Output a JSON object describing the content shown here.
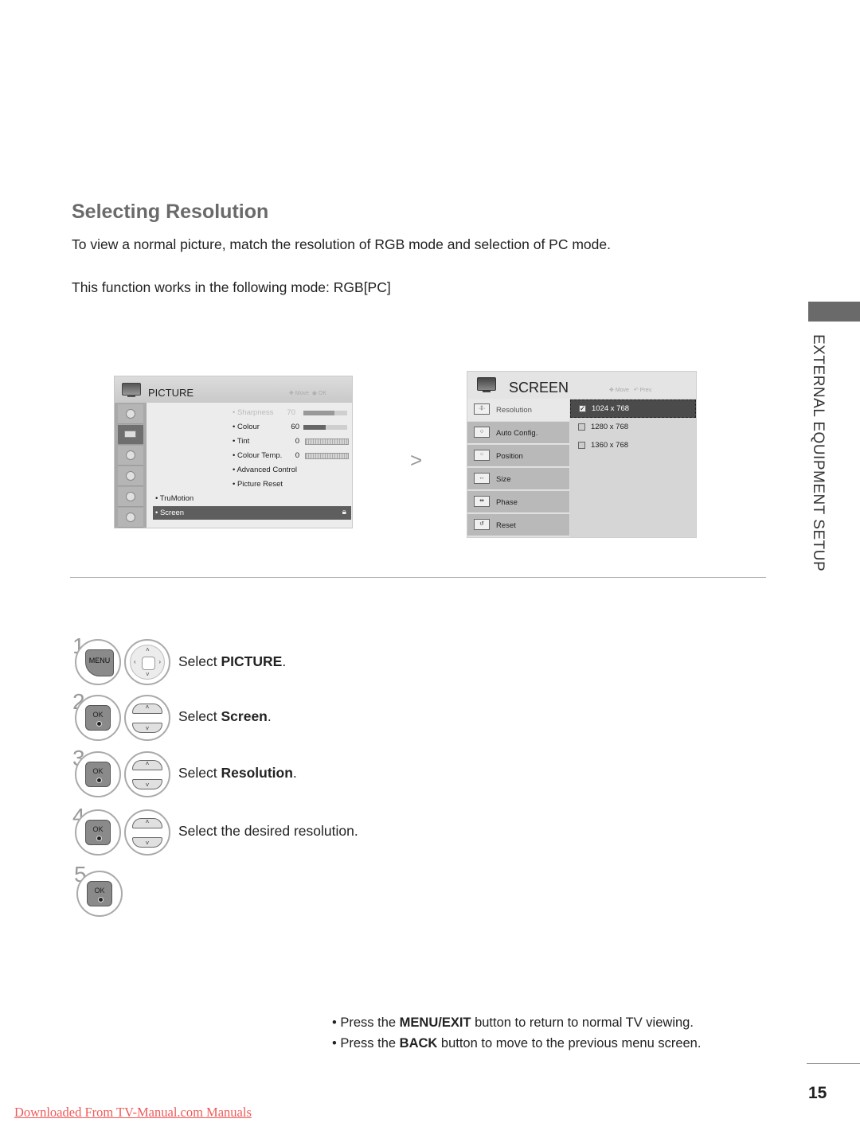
{
  "page": {
    "title": "Selecting Resolution",
    "intro": "To view a normal picture, match the resolution of RGB mode and selection of PC mode.",
    "mode_note": "This function works in the following mode: RGB[PC]",
    "section_label": "EXTERNAL EQUIPMENT SETUP",
    "page_number": "15",
    "footer_link": "Downloaded From TV-Manual.com Manuals"
  },
  "picture_menu": {
    "title": "PICTURE",
    "hint_move": "Move",
    "hint_ok": "OK",
    "sidebar_icons": [
      "picture-mode-icon",
      "picture-icon",
      "audio-icon",
      "time-icon",
      "lock-icon",
      "option-icon"
    ],
    "items": [
      {
        "label": "• Sharpness",
        "value": "70",
        "control": "bar",
        "level": 0.7,
        "faded": true
      },
      {
        "label": "• Colour",
        "value": "60",
        "control": "bar",
        "level": 0.5
      },
      {
        "label": "• Tint",
        "value": "0",
        "control": "scale",
        "scale_left": "R",
        "scale_right": "G"
      },
      {
        "label": "• Colour Temp.",
        "value": "0",
        "control": "scale",
        "scale_left": "W",
        "scale_right": "C"
      },
      {
        "label": "• Advanced Control"
      },
      {
        "label": "• Picture Reset"
      },
      {
        "label": "• TruMotion"
      },
      {
        "label": "• Screen",
        "selected": true
      }
    ]
  },
  "screen_menu": {
    "title": "SCREEN",
    "hint_move": "Move",
    "hint_prev": "Prev.",
    "items": [
      {
        "label": "Resolution",
        "active": true
      },
      {
        "label": "Auto Config."
      },
      {
        "label": "Position"
      },
      {
        "label": "Size"
      },
      {
        "label": "Phase"
      },
      {
        "label": "Reset"
      }
    ],
    "options": [
      {
        "label": "1024 x 768",
        "checked": true
      },
      {
        "label": "1280 x 768",
        "checked": false
      },
      {
        "label": "1360 x 768",
        "checked": false
      }
    ]
  },
  "steps": [
    {
      "num": "1",
      "prefix": "Select ",
      "bold": "PICTURE",
      "suffix": ".",
      "buttons": [
        "MENU",
        "NAV"
      ]
    },
    {
      "num": "2",
      "prefix": "Select ",
      "bold": "Screen",
      "suffix": ".",
      "buttons": [
        "OK",
        "UPDOWN"
      ]
    },
    {
      "num": "3",
      "prefix": "Select ",
      "bold": "Resolution",
      "suffix": ".",
      "buttons": [
        "OK",
        "UPDOWN"
      ]
    },
    {
      "num": "4",
      "prefix": "Select the desired resolution.",
      "bold": "",
      "suffix": "",
      "buttons": [
        "OK",
        "UPDOWN"
      ]
    },
    {
      "num": "5",
      "prefix": "",
      "bold": "",
      "suffix": "",
      "buttons": [
        "OK"
      ]
    }
  ],
  "button_labels": {
    "menu": "MENU",
    "ok": "OK"
  },
  "notes": [
    {
      "prefix": "• Press the ",
      "bold": "MENU/EXIT",
      "suffix": " button to return to normal TV viewing."
    },
    {
      "prefix": "• Press the ",
      "bold": "BACK",
      "suffix": " button to move to the previous menu screen."
    }
  ],
  "arrow_glyph": ">"
}
